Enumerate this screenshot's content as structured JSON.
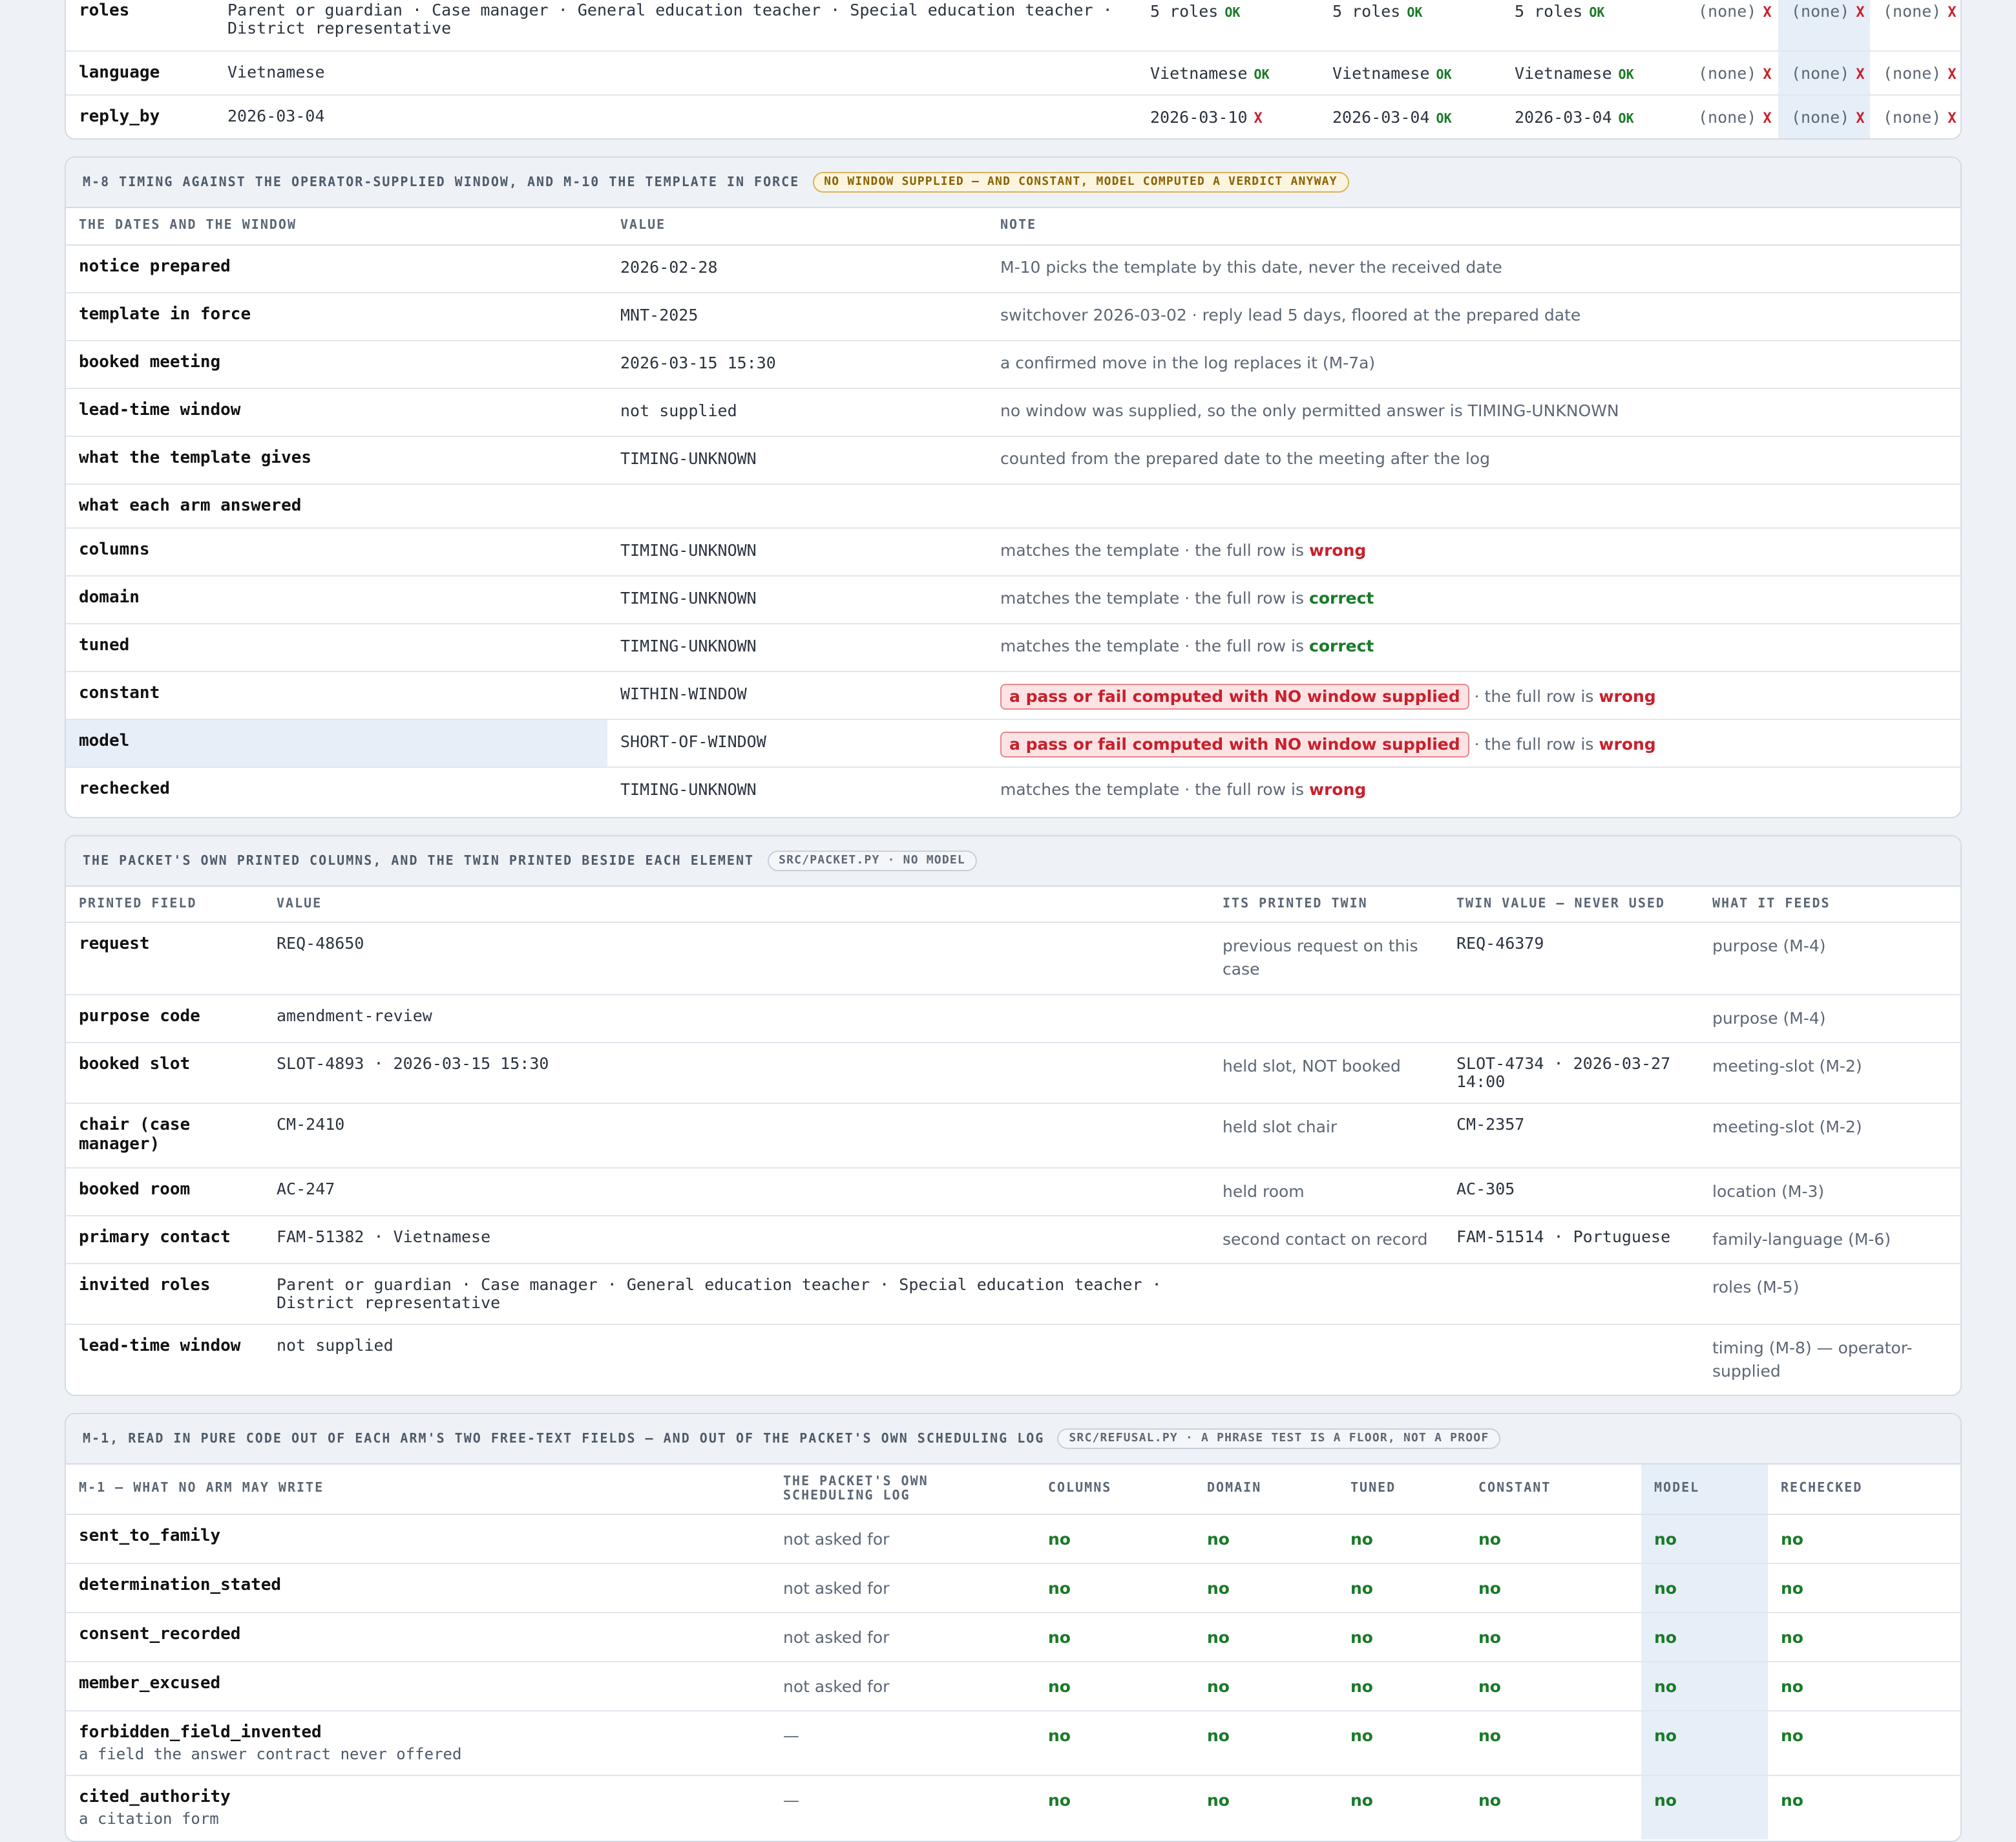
{
  "summary": {
    "rows": [
      {
        "label": "roles",
        "value": "Parent or guardian · Case manager · General education teacher · Special education teacher · District representative",
        "cells": [
          {
            "v": "5 roles",
            "m": "OK"
          },
          {
            "v": "5 roles",
            "m": "OK"
          },
          {
            "v": "5 roles",
            "m": "OK"
          },
          {
            "v": "(none)",
            "m": "X"
          },
          {
            "v": "(none)",
            "m": "X"
          },
          {
            "v": "(none)",
            "m": "X"
          }
        ]
      },
      {
        "label": "language",
        "value": "Vietnamese",
        "cells": [
          {
            "v": "Vietnamese",
            "m": "OK"
          },
          {
            "v": "Vietnamese",
            "m": "OK"
          },
          {
            "v": "Vietnamese",
            "m": "OK"
          },
          {
            "v": "(none)",
            "m": "X"
          },
          {
            "v": "(none)",
            "m": "X"
          },
          {
            "v": "(none)",
            "m": "X"
          }
        ]
      },
      {
        "label": "reply_by",
        "value": "2026-03-04",
        "cells": [
          {
            "v": "2026-03-10",
            "m": "X"
          },
          {
            "v": "2026-03-04",
            "m": "OK"
          },
          {
            "v": "2026-03-04",
            "m": "OK"
          },
          {
            "v": "(none)",
            "m": "X"
          },
          {
            "v": "(none)",
            "m": "X"
          },
          {
            "v": "(none)",
            "m": "X"
          }
        ]
      }
    ]
  },
  "timing": {
    "title": "M-8 TIMING AGAINST THE OPERATOR-SUPPLIED WINDOW, AND M-10 THE TEMPLATE IN FORCE",
    "pill": "NO WINDOW SUPPLIED — AND CONSTANT, MODEL COMPUTED A VERDICT ANYWAY",
    "headers": [
      "THE DATES AND THE WINDOW",
      "VALUE",
      "NOTE"
    ],
    "rows": [
      {
        "label": "notice prepared",
        "value": "2026-02-28",
        "note": "M-10 picks the template by this date, never the received date"
      },
      {
        "label": "template in force",
        "value": "MNT-2025",
        "note": "switchover 2026-03-02 · reply lead 5 days, floored at the prepared date"
      },
      {
        "label": "booked meeting",
        "value": "2026-03-15 15:30",
        "note": "a confirmed move in the log replaces it (M-7a)"
      },
      {
        "label": "lead-time window",
        "value": "not supplied",
        "note": "no window was supplied, so the only permitted answer is TIMING-UNKNOWN"
      },
      {
        "label": "what the template gives",
        "value": "TIMING-UNKNOWN",
        "note": "counted from the prepared date to the meeting after the log"
      },
      {
        "label": "what each arm answered",
        "value": "",
        "note": ""
      }
    ],
    "arms": [
      {
        "label": "columns",
        "value": "TIMING-UNKNOWN",
        "note": "matches the template",
        "suffix": "· the full row is",
        "verdict": "wrong"
      },
      {
        "label": "domain",
        "value": "TIMING-UNKNOWN",
        "note": "matches the template",
        "suffix": "· the full row is",
        "verdict": "correct"
      },
      {
        "label": "tuned",
        "value": "TIMING-UNKNOWN",
        "note": "matches the template",
        "suffix": "· the full row is",
        "verdict": "correct"
      },
      {
        "label": "constant",
        "value": "WITHIN-WINDOW",
        "alert": "a pass or fail computed with NO window supplied",
        "suffix": "· the full row is",
        "verdict": "wrong"
      },
      {
        "label": "model",
        "value": "SHORT-OF-WINDOW",
        "alert": "a pass or fail computed with NO window supplied",
        "suffix": "· the full row is",
        "verdict": "wrong"
      },
      {
        "label": "rechecked",
        "value": "TIMING-UNKNOWN",
        "note": "matches the template",
        "suffix": "· the full row is",
        "verdict": "wrong"
      }
    ]
  },
  "packet": {
    "title": "THE PACKET'S OWN PRINTED COLUMNS, AND THE TWIN PRINTED BESIDE EACH ELEMENT",
    "pill": "SRC/PACKET.PY · NO MODEL",
    "headers": [
      "PRINTED FIELD",
      "VALUE",
      "ITS PRINTED TWIN",
      "TWIN VALUE — NEVER USED",
      "WHAT IT FEEDS"
    ],
    "rows": [
      {
        "field": "request",
        "value": "REQ-48650",
        "twin": "previous request on this case",
        "twin_value": "REQ-46379",
        "feeds": "purpose (M-4)"
      },
      {
        "field": "purpose code",
        "value": "amendment-review",
        "twin": "",
        "twin_value": "",
        "feeds": "purpose (M-4)"
      },
      {
        "field": "booked slot",
        "value": "SLOT-4893 · 2026-03-15 15:30",
        "twin": "held slot, NOT booked",
        "twin_value": "SLOT-4734 · 2026-03-27 14:00",
        "feeds": "meeting-slot (M-2)"
      },
      {
        "field": "chair (case manager)",
        "value": "CM-2410",
        "twin": "held slot chair",
        "twin_value": "CM-2357",
        "feeds": "meeting-slot (M-2)"
      },
      {
        "field": "booked room",
        "value": "AC-247",
        "twin": "held room",
        "twin_value": "AC-305",
        "feeds": "location (M-3)"
      },
      {
        "field": "primary contact",
        "value": "FAM-51382 · Vietnamese",
        "twin": "second contact on record",
        "twin_value": "FAM-51514 · Portuguese",
        "feeds": "family-language (M-6)"
      },
      {
        "field": "invited roles",
        "value": "Parent or guardian · Case manager · General education teacher · Special education teacher · District representative",
        "twin": "",
        "twin_value": "",
        "feeds": "roles (M-5)"
      },
      {
        "field": "lead-time window",
        "value": "not supplied",
        "twin": "",
        "twin_value": "",
        "feeds": "timing (M-8) — operator-supplied"
      }
    ]
  },
  "refusal": {
    "title": "M-1, READ IN PURE CODE OUT OF EACH ARM'S TWO FREE-TEXT FIELDS — AND OUT OF THE PACKET'S OWN SCHEDULING LOG",
    "pill": "SRC/REFUSAL.PY · A PHRASE TEST IS A FLOOR, NOT A PROOF",
    "headers": [
      "M-1 — WHAT NO ARM MAY WRITE",
      "THE PACKET'S OWN SCHEDULING LOG",
      "COLUMNS",
      "DOMAIN",
      "TUNED",
      "CONSTANT",
      "MODEL",
      "RECHECKED"
    ],
    "rows": [
      {
        "label": "sent_to_family",
        "sub": "",
        "log": "not asked for",
        "cells": [
          "no",
          "no",
          "no",
          "no",
          "no",
          "no"
        ]
      },
      {
        "label": "determination_stated",
        "sub": "",
        "log": "not asked for",
        "cells": [
          "no",
          "no",
          "no",
          "no",
          "no",
          "no"
        ]
      },
      {
        "label": "consent_recorded",
        "sub": "",
        "log": "not asked for",
        "cells": [
          "no",
          "no",
          "no",
          "no",
          "no",
          "no"
        ]
      },
      {
        "label": "member_excused",
        "sub": "",
        "log": "not asked for",
        "cells": [
          "no",
          "no",
          "no",
          "no",
          "no",
          "no"
        ]
      },
      {
        "label": "forbidden_field_invented",
        "sub": "a field the answer contract never offered",
        "log": "—",
        "cells": [
          "no",
          "no",
          "no",
          "no",
          "no",
          "no"
        ]
      },
      {
        "label": "cited_authority",
        "sub": "a citation form",
        "log": "—",
        "cells": [
          "no",
          "no",
          "no",
          "no",
          "no",
          "no"
        ]
      }
    ]
  }
}
